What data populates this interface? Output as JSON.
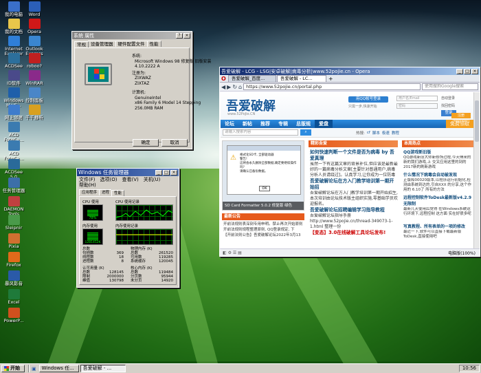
{
  "desktop_icons": [
    {
      "label": "我的电脑",
      "color": "#3a6fc9"
    },
    {
      "label": "Word",
      "color": "#2b5fb8"
    },
    {
      "label": "我的文档",
      "color": "#e8c64a"
    },
    {
      "label": "Opera",
      "color": "#d01818"
    },
    {
      "label": "Internet Explorer",
      "color": "#2f7fd8"
    },
    {
      "label": "Outlook Express",
      "color": "#3a86d0"
    },
    {
      "label": "ACDSee",
      "color": "#2c6f9c"
    },
    {
      "label": "roboo?",
      "color": "#c02020"
    },
    {
      "label": "ID软件",
      "color": "#4a4a8a"
    },
    {
      "label": "WinRAR",
      "color": "#8a2a8a"
    },
    {
      "label": "Windows Medi...",
      "color": "#1e5faa"
    },
    {
      "label": "控制面板",
      "color": "#4a86c8"
    },
    {
      "label": "网上邻居",
      "color": "#3f7ccc"
    },
    {
      "label": "千千静听",
      "color": "#d8a020"
    },
    {
      "label": "ACD FotoCa...",
      "color": "#3b7bb0"
    },
    {
      "label": "ACD FotoCa...",
      "color": "#3b7bb0"
    },
    {
      "label": "ACDSee 5.0",
      "color": "#2a6a9a"
    },
    {
      "label": "任务管理器",
      "color": "#3c6fa8"
    },
    {
      "label": "DAEMON Tools",
      "color": "#c04040"
    },
    {
      "label": "Sleipnir",
      "color": "#4a9a4a"
    },
    {
      "label": "Pixia",
      "color": "#d07030"
    },
    {
      "label": "Firefox",
      "color": "#e06a1a"
    },
    {
      "label": "暴风影音",
      "color": "#2a5aa8"
    },
    {
      "label": "Excel",
      "color": "#1f7a3a"
    },
    {
      "label": "PowerP...",
      "color": "#d0501e"
    }
  ],
  "sysprops": {
    "title": "系统 属性",
    "help": "?",
    "close": "×",
    "tabs": [
      "常规",
      "设备管理器",
      "硬件配置文件",
      "性能"
    ],
    "system_label": "系统:",
    "system_lines": [
      "Microsoft Windows 98 修复版 旧版安装",
      "4.10.2222 A"
    ],
    "reg_label": "注册为:",
    "reg_lines": [
      "ZIXWAZ",
      "ZIXTAZ"
    ],
    "computer_label": "计算机:",
    "computer_lines": [
      "GenuineIntel",
      "x86 Family 6 Model 14 Stepping",
      "256.0MB RAM"
    ],
    "ok": "确定",
    "cancel": "取消"
  },
  "taskmgr": {
    "title": "Windows 任务管理器",
    "menu": [
      "文件(F)",
      "选项(O)",
      "查看(V)",
      "关机(U)",
      "帮助(H)"
    ],
    "tabs": [
      "应用程序",
      "进程",
      "性能"
    ],
    "cpu_usage_label": "CPU 使用",
    "cpu_usage_value": "78%",
    "cpu_history_label": "CPU 使用记录",
    "mem_usage_label": "内存使用",
    "mem_usage_value": "1281452K",
    "mem_history_label": "内存使用记录",
    "totals_label": "总数",
    "totals": [
      [
        "句柄数",
        "369"
      ],
      [
        "线程数",
        "18"
      ],
      [
        "进程数",
        "8"
      ]
    ],
    "physical_label": "物理内存 (K)",
    "physical": [
      [
        "总数",
        "261520"
      ],
      [
        "可用数",
        "119285"
      ],
      [
        "系统缓存",
        "120045"
      ]
    ],
    "commit_label": "认可用量 (K)",
    "commit": [
      [
        "总数",
        "128145"
      ],
      [
        "限制",
        "2000000"
      ],
      [
        "峰值",
        "130798"
      ]
    ],
    "kernel_label": "核心内存 (K)",
    "kernel": [
      [
        "总数",
        "119484"
      ],
      [
        "分页数",
        "95944"
      ],
      [
        "未分页",
        "14920"
      ]
    ],
    "cpu_level": 0.78
  },
  "browser": {
    "title": "吾爱破解 - LCG - LSG|安卓破解|病毒分析|www.52pojie.cn - Opera",
    "tabs": [
      "吾爱破解_百度...",
      "吾爱破解 - LC..."
    ],
    "url": "https://www.52pojie.cn/portal.php",
    "search_placeholder": "使用搜狗Google搜索",
    "login_btn": "用QQ帐号登录",
    "login_sub": "只需一步,快速开始",
    "user_placeholder": "用户名/Email",
    "pass_label": "密码",
    "auto_login": "自动登录",
    "find_pwd": "找回密码",
    "login": "登录",
    "register": "注册[Register]",
    "nav": [
      "论坛",
      "新帖",
      "推荐",
      "专辑",
      "总版规",
      "爱盘",
      "免费领取"
    ],
    "search_text": "请输入搜索内容",
    "hot_label": "热搜:",
    "hot": [
      "cf",
      "脚本",
      "极速",
      "教程"
    ],
    "caption": "SD Card Formatter 5.0.2 修复版 绿色",
    "fetch_title": "精彩吾爱",
    "col_title": "本周热点",
    "news": [
      {
        "title": "如何快速判断一个文件是否为病毒 by 吾爱真理",
        "text": "虽然一下有这篇文章的背景补位,但应该是最新最好的一篇病毒分析文章[主要针对普通用户,病毒分析人员请绕过]。认真学习,让你成为一位防毒达人。"
      },
      {
        "title": "吾爱破解论坛在方入门教学培训第一期开始招",
        "text": "吾爱破解论坛在方入门教学培训第一期开始招生,本次培训由论坛技术版主组织实施,零基础学员欢迎报名。"
      },
      {
        "title": "吾爱破解论坛招聘编辑学习指导教程",
        "text": "吾爱破解论坛指导手册 http://www.52pojie.cn/thread-349073-1-1.html 整理一份"
      },
      {
        "title": "【变态】3.0在线破解工具论坛发布!",
        "text": ""
      }
    ],
    "notice_title": "最新公告",
    "notices": [
      "开前法规则表深刻专用申明。禁止再次开始原则",
      "开前法规则规程整理原则, QQ登录规定, 下",
      "【开前法则公告】吾爱破解论坛2022年3月13"
    ],
    "hot_items": [
      {
        "title": "QQ游戏新旧版",
        "text": "QQ游戏新旧大师新修饰过程,今天傅来的新的我们游戏,上 交叉应用这里的到的 2017新的刷新游戏"
      },
      {
        "title": "什么情况下病毒会自动被发现",
        "text": "正版和00020版本,以程序运行初始化,检测由系统到达的,引自XXX 的分享,这个作用的 6.10了 所有的方法"
      },
      {
        "title": "远程控制软件ToDesk最新版v4.2.9无限制",
        "text": "最新几天使用后觉得 在Windows系统运行环境下,远程控制 这方面 实在好很多呢"
      },
      {
        "title": "写真教程、所有表单的一项的修改",
        "text": "最近一下,软件可以直接下载最新版 ToDesk,直接使用吧"
      }
    ],
    "status_zoom": "电脑版(100%)",
    "popup_lines": [
      "格式化SD卡, 全部驱动器",
      "警告!",
      "这将会永久删除全部数据,确定要继续操作吗?",
      "请确认已备份数据。"
    ],
    "popup_ok": "OK"
  },
  "taskbar": {
    "start": "开始",
    "items": [
      "Windows 任...",
      "吾爱破解 - ..."
    ],
    "clock": "10:56"
  }
}
